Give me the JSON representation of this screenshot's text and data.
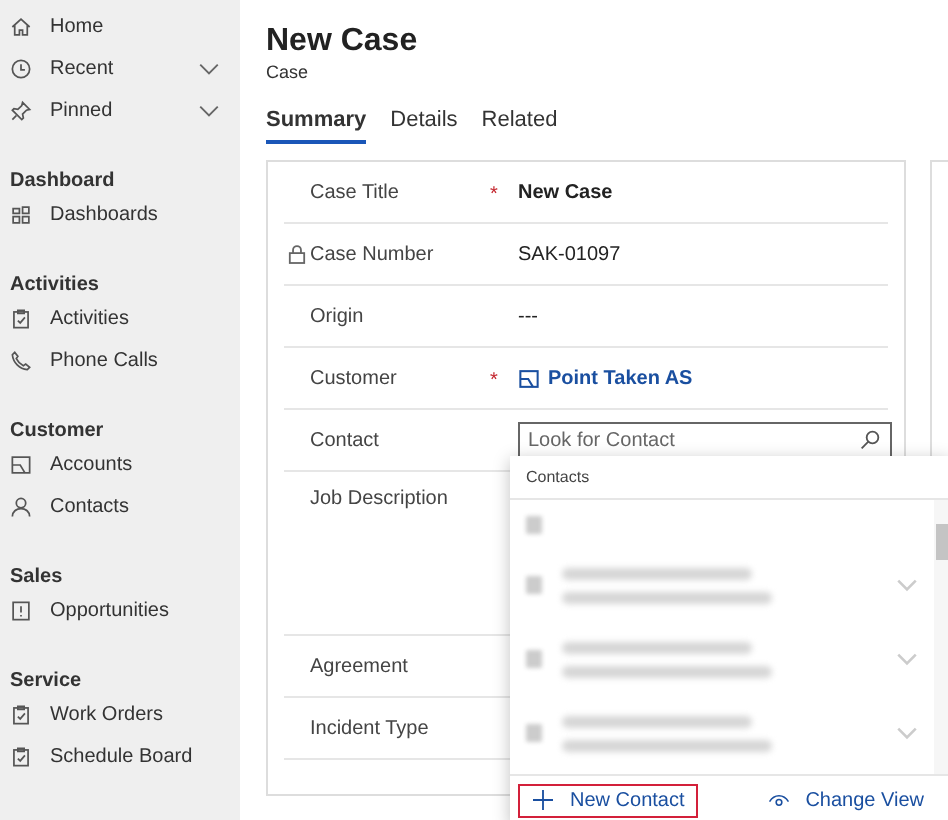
{
  "sidebar": {
    "items": [
      {
        "kind": "home",
        "label": "Home"
      },
      {
        "kind": "clock",
        "label": "Recent",
        "expandable": true
      },
      {
        "kind": "pin",
        "label": "Pinned",
        "expandable": true
      },
      {
        "kind": "header",
        "label": "Dashboard"
      },
      {
        "kind": "dashboard",
        "label": "Dashboards"
      },
      {
        "kind": "header",
        "label": "Activities"
      },
      {
        "kind": "clipboard",
        "label": "Activities"
      },
      {
        "kind": "phone",
        "label": "Phone Calls"
      },
      {
        "kind": "header",
        "label": "Customer"
      },
      {
        "kind": "account",
        "label": "Accounts"
      },
      {
        "kind": "person",
        "label": "Contacts"
      },
      {
        "kind": "header",
        "label": "Sales"
      },
      {
        "kind": "opportunity",
        "label": "Opportunities"
      },
      {
        "kind": "header",
        "label": "Service"
      },
      {
        "kind": "clipboard",
        "label": "Work Orders"
      },
      {
        "kind": "clipboard",
        "label": "Schedule Board"
      }
    ]
  },
  "header": {
    "title": "New Case",
    "subtitle": "Case"
  },
  "tabs": [
    {
      "label": "Summary",
      "selected": true
    },
    {
      "label": "Details",
      "selected": false
    },
    {
      "label": "Related",
      "selected": false
    }
  ],
  "form": {
    "fields": [
      {
        "kind": "text",
        "label": "Case Title",
        "required_marker": "*",
        "value": "New Case",
        "bold": true
      },
      {
        "kind": "text",
        "label": "Case Number",
        "locked": true,
        "value": "SAK-01097"
      },
      {
        "kind": "text",
        "label": "Origin",
        "value": "---"
      },
      {
        "kind": "link",
        "label": "Customer",
        "required_marker": "*",
        "value": "Point Taken AS"
      },
      {
        "kind": "lookup",
        "label": "Contact",
        "placeholder": "Look for Contact"
      },
      {
        "kind": "textarea",
        "label": "Job Description"
      },
      {
        "kind": "text",
        "label": "Agreement"
      },
      {
        "kind": "text",
        "label": "Incident Type"
      }
    ]
  },
  "dropdown": {
    "header": "Contacts",
    "results": [
      {
        "kind": "blank"
      },
      {
        "kind": "contact"
      },
      {
        "kind": "contact"
      },
      {
        "kind": "contact"
      }
    ],
    "actions": [
      {
        "kind": "new",
        "label": "New Contact",
        "highlighted": true
      },
      {
        "kind": "view",
        "label": "Change View",
        "highlighted": false
      }
    ]
  }
}
